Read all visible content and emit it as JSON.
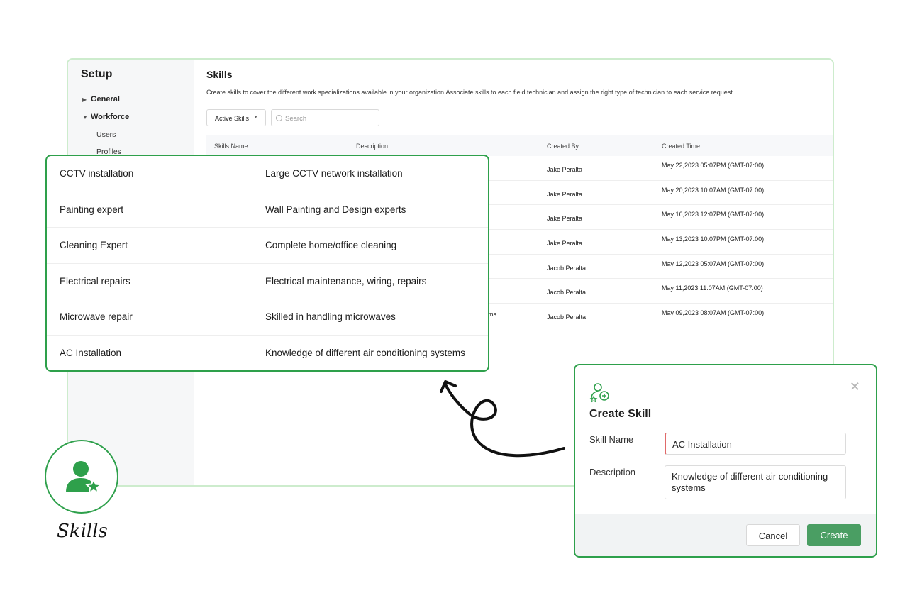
{
  "sidebar": {
    "title": "Setup",
    "general_label": "General",
    "workforce_label": "Workforce",
    "sub_items": [
      "Users",
      "Profiles"
    ]
  },
  "header": {
    "title": "Skills",
    "description": "Create skills to cover the different work specializations available in your organization.Associate skills to each field technician and assign the right type of technician to each service request."
  },
  "toolbar": {
    "filter_label": "Active Skills",
    "search_placeholder": "Search"
  },
  "table": {
    "columns": [
      "Skills Name",
      "Description",
      "Created By",
      "Created Time"
    ],
    "rows": [
      {
        "created_by": "Jake Peralta",
        "created_time": "May 22,2023 05:07PM (GMT-07:00)",
        "desc_tail": ""
      },
      {
        "created_by": "Jake Peralta",
        "created_time": "May 20,2023 10:07AM (GMT-07:00)",
        "desc_tail": ""
      },
      {
        "created_by": "Jake Peralta",
        "created_time": "May 16,2023 12:07PM (GMT-07:00)",
        "desc_tail": ""
      },
      {
        "created_by": "Jake Peralta",
        "created_time": "May 13,2023 10:07PM (GMT-07:00)",
        "desc_tail": ""
      },
      {
        "created_by": "Jacob Peralta",
        "created_time": "May 12,2023 05:07AM (GMT-07:00)",
        "desc_tail": ""
      },
      {
        "created_by": "Jacob Peralta",
        "created_time": "May 11,2023 11:07AM (GMT-07:00)",
        "desc_tail": ""
      },
      {
        "created_by": "Jacob Peralta",
        "created_time": "May 09,2023 08:07AM (GMT-07:00)",
        "desc_tail": "ms"
      }
    ]
  },
  "zoom": {
    "rows": [
      {
        "name": "CCTV installation",
        "description": "Large CCTV network installation"
      },
      {
        "name": "Painting expert",
        "description": "Wall Painting and Design experts"
      },
      {
        "name": "Cleaning Expert",
        "description": "Complete home/office cleaning"
      },
      {
        "name": "Electrical repairs",
        "description": "Electrical maintenance, wiring, repairs"
      },
      {
        "name": "Microwave repair",
        "description": "Skilled in handling microwaves"
      },
      {
        "name": "AC Installation",
        "description": "Knowledge of different air conditioning systems"
      }
    ]
  },
  "dialog": {
    "icon": "add-skill-icon",
    "close_icon": "close-icon",
    "title": "Create Skill",
    "skill_name_label": "Skill Name",
    "skill_name_value": "AC Installation",
    "description_label": "Description",
    "description_value": "Knowledge of different air conditioning systems",
    "cancel_label": "Cancel",
    "create_label": "Create"
  },
  "badge": {
    "icon": "user-star-icon",
    "label": "Skills"
  },
  "colors": {
    "accent_green": "#2ea04b",
    "create_button": "#4a9e63",
    "required_marker": "#e06a6a"
  }
}
